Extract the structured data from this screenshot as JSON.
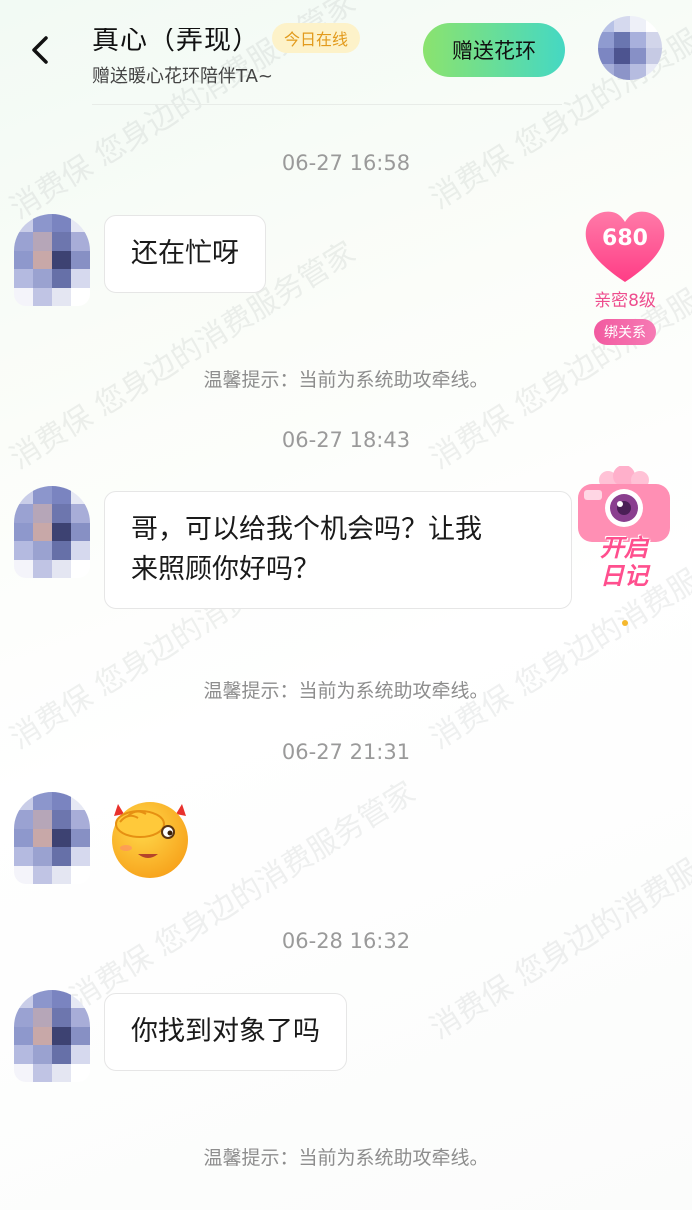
{
  "header": {
    "title": "真心（弄现）",
    "online_badge": "今日在线",
    "subtitle": "赠送暖心花环陪伴TA~",
    "gift_button": "赠送花环"
  },
  "intimacy": {
    "value": "680",
    "level": "亲密8级",
    "bind_button": "绑关系"
  },
  "diary": {
    "label_line1": "开启",
    "label_line2": "日记"
  },
  "messages": [
    {
      "time": "06-27 16:58",
      "text": "还在忙呀"
    },
    {
      "time": "06-27 18:43",
      "text": "哥，可以给我个机会吗？让我\n来照顾你好吗？"
    },
    {
      "time": "06-27 21:31",
      "sticker": "facepalm-emoji"
    },
    {
      "time": "06-28 16:32",
      "text": "你找到对象了吗"
    }
  ],
  "tips": [
    "温馨提示：当前为系统助攻牵线。",
    "温馨提示：当前为系统助攻牵线。",
    "温馨提示：当前为系统助攻牵线。"
  ],
  "watermark": "消费保 您身边的消费服务管家",
  "colors": {
    "accent_pink": "#ee4d8e",
    "online_badge_text": "#e29a1c",
    "gift_gradient_start": "#8be36e",
    "gift_gradient_end": "#45d8c3"
  }
}
